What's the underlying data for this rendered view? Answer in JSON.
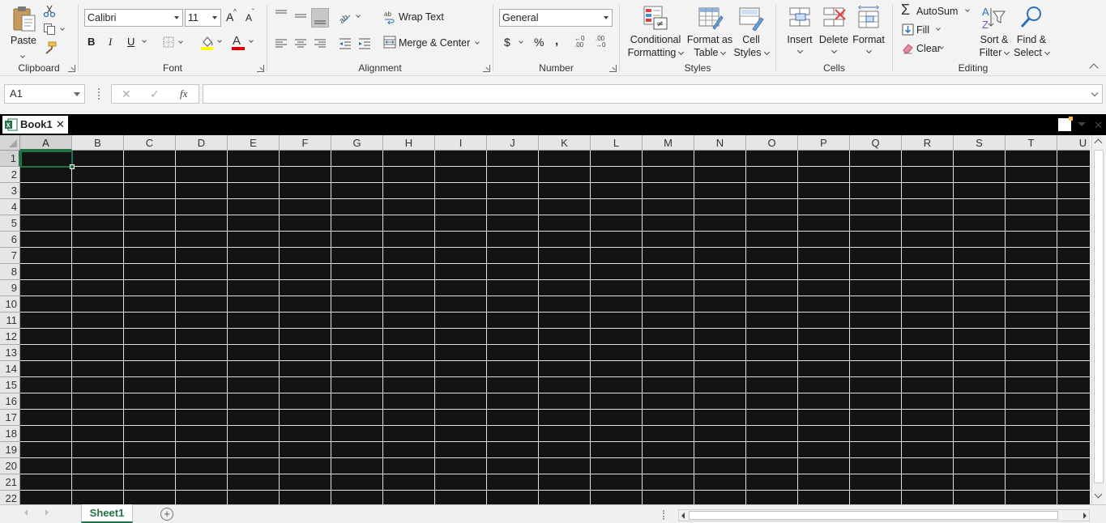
{
  "ribbon": {
    "clipboard": {
      "label": "Clipboard",
      "paste": "Paste"
    },
    "font": {
      "label": "Font",
      "name": "Calibri",
      "size": "11",
      "bold": "B",
      "italic": "I",
      "underline": "U",
      "grow": "A",
      "shrink": "A",
      "font_color_glyph": "A"
    },
    "alignment": {
      "label": "Alignment",
      "wrap_text": "Wrap Text",
      "merge_center": "Merge & Center"
    },
    "number": {
      "label": "Number",
      "format": "General",
      "currency": "$",
      "percent": "%",
      "comma": ",",
      "inc_decimal": "←0 .00",
      "dec_decimal": ".00 →0"
    },
    "styles": {
      "label": "Styles",
      "conditional_1": "Conditional",
      "conditional_2": "Formatting",
      "format_table_1": "Format as",
      "format_table_2": "Table",
      "cell_styles_1": "Cell",
      "cell_styles_2": "Styles"
    },
    "cells": {
      "label": "Cells",
      "insert": "Insert",
      "delete": "Delete",
      "format": "Format"
    },
    "editing": {
      "label": "Editing",
      "autosum": "AutoSum",
      "fill": "Fill",
      "clear": "Clear",
      "sort_1": "Sort &",
      "sort_2": "Filter",
      "find_1": "Find &",
      "find_2": "Select"
    }
  },
  "formula_bar": {
    "name_box": "A1",
    "cancel": "✕",
    "enter": "✓",
    "fx": "fx",
    "value": ""
  },
  "workbook": {
    "title": "Book1",
    "close": "✕"
  },
  "grid": {
    "columns": [
      "A",
      "B",
      "C",
      "D",
      "E",
      "F",
      "G",
      "H",
      "I",
      "J",
      "K",
      "L",
      "M",
      "N",
      "O",
      "P",
      "Q",
      "R",
      "S",
      "T",
      "U"
    ],
    "rows": [
      "1",
      "2",
      "3",
      "4",
      "5",
      "6",
      "7",
      "8",
      "9",
      "10",
      "11",
      "12",
      "13",
      "14",
      "15",
      "16",
      "17",
      "18",
      "19",
      "20",
      "21",
      "22"
    ],
    "active_cell": "A1"
  },
  "sheet_tabs": {
    "active": "Sheet1",
    "add": "+"
  },
  "colors": {
    "accent": "#217346",
    "grid_bg": "#131313",
    "grid_line": "#e0e0e0",
    "highlight_yellow": "#ffff00",
    "font_red": "#e00000"
  }
}
